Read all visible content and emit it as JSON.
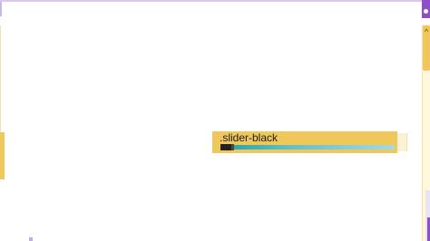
{
  "slider": {
    "label": ".slider-black",
    "value_fraction": 0.07
  },
  "scrollbar": {
    "up_arrow": "^"
  },
  "colors": {
    "accent_yellow": "#f0c75a",
    "accent_purple": "#8e4fc9",
    "track_teal": "#1aa3a9",
    "slider_fill": "#222222"
  },
  "icons": {
    "corner": "corner-badge-icon",
    "scroll_up": "chevron-up-icon"
  }
}
